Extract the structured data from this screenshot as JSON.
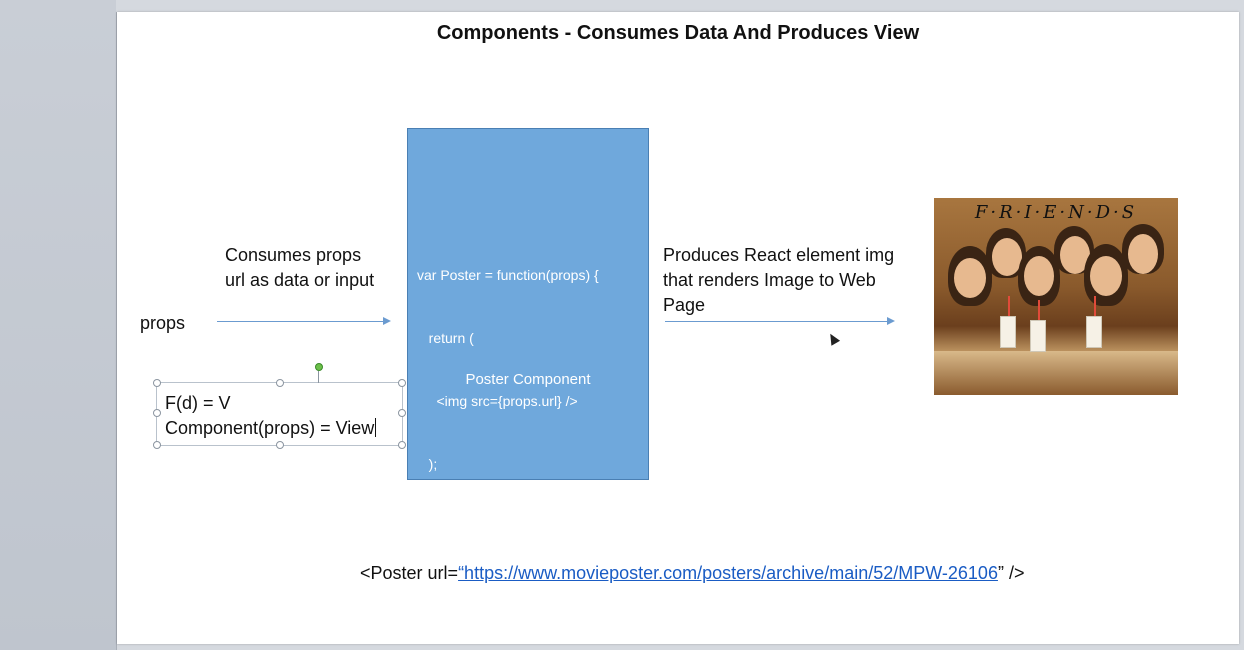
{
  "slide": {
    "title": "Components - Consumes Data And Produces View",
    "props_label": "props",
    "consumes_line1": "Consumes props",
    "consumes_line2": "url as data or input",
    "produces_line1": "Produces React element img",
    "produces_line2": "that renders Image to Web",
    "produces_line3": "Page",
    "code_lines": [
      "var Poster = function(props) {",
      "   return (",
      "     <img src={props.url} />",
      "   );",
      "};"
    ],
    "box_caption": "Poster Component",
    "formula_line1": "F(d) = V",
    "formula_line2": "Component(props) = View",
    "poster_title": "F·R·I·E·N·D·S",
    "bottom_prefix": "<Poster url=",
    "bottom_link": "“https://www.movieposter.com/posters/archive/main/52/MPW-26106",
    "bottom_suffix": "” />"
  },
  "colors": {
    "box_fill": "#6fa8dc",
    "arrow": "#6b9bd0",
    "link": "#1a5cc4"
  }
}
